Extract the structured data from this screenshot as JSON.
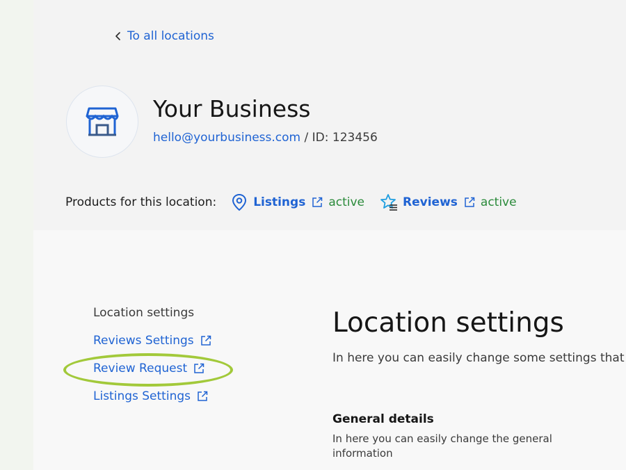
{
  "nav": {
    "back_label": "To all locations"
  },
  "business": {
    "name": "Your Business",
    "email": "hello@yourbusiness.com",
    "id_text": " / ID: 123456",
    "logo_icon": "storefront-icon"
  },
  "products": {
    "label": "Products for this location:",
    "items": [
      {
        "name": "Listings",
        "status": "active",
        "icon": "location-pin-icon"
      },
      {
        "name": "Reviews",
        "status": "active",
        "icon": "star-review-icon"
      }
    ]
  },
  "sidebar": {
    "title": "Location settings",
    "links": [
      {
        "label": "Reviews Settings"
      },
      {
        "label": "Review Request",
        "highlighted": true
      },
      {
        "label": "Listings Settings"
      }
    ]
  },
  "main": {
    "title": "Location settings",
    "description": "In here you can easily change some settings that w",
    "section": {
      "title": "General details",
      "description": "In here you can easily change the general information"
    }
  },
  "colors": {
    "link": "#1f63d3",
    "active": "#2a8a3a",
    "highlight": "#a2c93a"
  }
}
